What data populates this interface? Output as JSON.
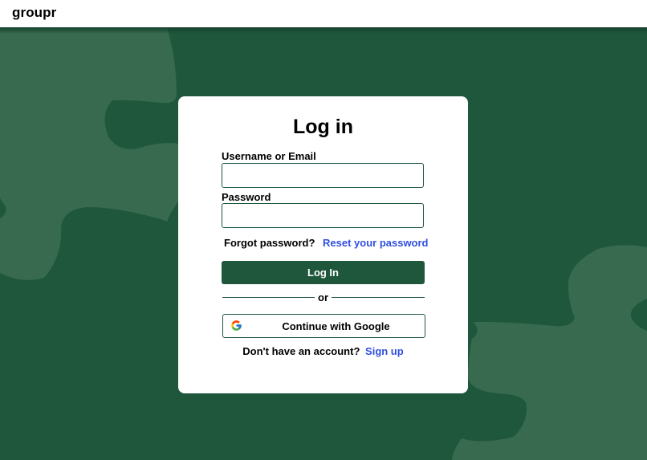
{
  "header": {
    "brand": "groupr"
  },
  "login_card": {
    "title": "Log in",
    "username_label": "Username or Email",
    "username_value": "",
    "password_label": "Password",
    "password_value": "",
    "forgot_text": "Forgot password?",
    "reset_link": "Reset your password",
    "login_button": "Log In",
    "divider_text": "or",
    "google_button": "Continue with Google",
    "google_icon": "google-g-icon",
    "signup_text": "Don't have an account?",
    "signup_link": "Sign up"
  },
  "colors": {
    "primary_green": "#1f573d",
    "background_shape": "#376a4e",
    "link_blue": "#2f4fe0",
    "card_background": "#ffffff",
    "header_background": "#ffffff"
  }
}
